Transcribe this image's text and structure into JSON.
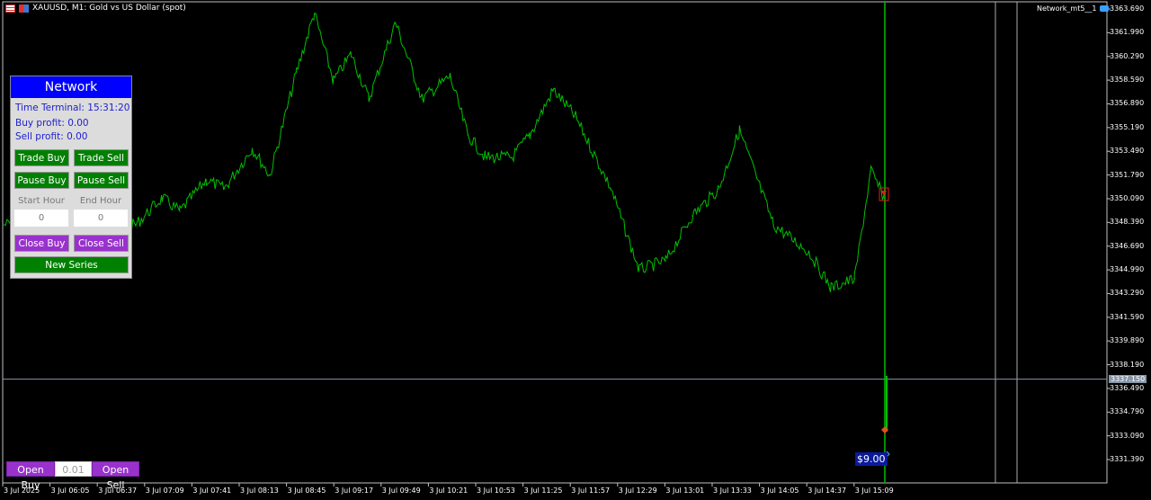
{
  "window": {
    "title": "XAUUSD, M1:  Gold vs US Dollar (spot)",
    "indicator": "Network_mt5__1"
  },
  "panel": {
    "title": "Network",
    "time_terminal": "Time Terminal: 15:31:20",
    "buy_profit": "Buy profit: 0.00",
    "sell_profit": "Sell profit: 0.00",
    "trade_buy": "Trade Buy",
    "trade_sell": "Trade Sell",
    "pause_buy": "Pause Buy",
    "pause_sell": "Pause Sell",
    "start_hour_label": "Start Hour",
    "end_hour_label": "End Hour",
    "start_hour": "0",
    "end_hour": "0",
    "close_buy": "Close Buy",
    "close_sell": "Close Sell",
    "new_series": "New Series"
  },
  "order": {
    "open_buy": "Open Buy",
    "lot": "0.01",
    "open_sell": "Open Sell"
  },
  "profit_label": "$9.00",
  "colors": {
    "line": "#00c000",
    "panel_header": "#0000ff",
    "green_button": "#008000",
    "purple_button": "#9932cc"
  },
  "chart_data": {
    "type": "line",
    "symbol": "XAUUSD",
    "timeframe": "M1",
    "price_ticks": [
      "3363.690",
      "3361.990",
      "3360.290",
      "3358.590",
      "3356.890",
      "3355.190",
      "3353.490",
      "3351.790",
      "3350.090",
      "3348.390",
      "3346.690",
      "3344.990",
      "3343.290",
      "3341.590",
      "3339.890",
      "3338.190",
      "3336.490",
      "3334.790",
      "3333.090",
      "3331.390"
    ],
    "time_ticks": [
      "3 Jul 2025",
      "3 Jul 06:05",
      "3 Jul 06:37",
      "3 Jul 07:09",
      "3 Jul 07:41",
      "3 Jul 08:13",
      "3 Jul 08:45",
      "3 Jul 09:17",
      "3 Jul 09:49",
      "3 Jul 10:21",
      "3 Jul 10:53",
      "3 Jul 11:25",
      "3 Jul 11:57",
      "3 Jul 12:29",
      "3 Jul 13:01",
      "3 Jul 13:33",
      "3 Jul 14:05",
      "3 Jul 14:37",
      "3 Jul 15:09"
    ],
    "current_price": "3337.150",
    "ylim": [
      3330.5,
      3364.2
    ],
    "points": [
      [
        "05:34",
        3348.22
      ],
      [
        "05:56",
        3348.54
      ],
      [
        "06:32",
        3347.89
      ],
      [
        "07:03",
        3348.22
      ],
      [
        "07:21",
        3350.15
      ],
      [
        "07:33",
        3349.18
      ],
      [
        "07:51",
        3351.44
      ],
      [
        "08:03",
        3350.8
      ],
      [
        "08:22",
        3353.7
      ],
      [
        "08:34",
        3351.76
      ],
      [
        "08:52",
        3359.18
      ],
      [
        "09:04",
        3363.37
      ],
      [
        "09:17",
        3358.53
      ],
      [
        "09:29",
        3360.47
      ],
      [
        "09:41",
        3357.24
      ],
      [
        "09:59",
        3362.72
      ],
      [
        "10:17",
        3357.24
      ],
      [
        "10:36",
        3358.85
      ],
      [
        "10:48",
        3354.66
      ],
      [
        "11:00",
        3353.05
      ],
      [
        "11:18",
        3353.05
      ],
      [
        "11:30",
        3354.66
      ],
      [
        "11:46",
        3357.89
      ],
      [
        "12:01",
        3355.95
      ],
      [
        "12:25",
        3350.8
      ],
      [
        "12:44",
        3344.99
      ],
      [
        "13:02",
        3345.64
      ],
      [
        "13:20",
        3348.86
      ],
      [
        "13:38",
        3350.8
      ],
      [
        "13:52",
        3354.99
      ],
      [
        "14:15",
        3348.22
      ],
      [
        "14:39",
        3346.28
      ],
      [
        "14:54",
        3343.7
      ],
      [
        "15:10",
        3344.35
      ],
      [
        "15:21",
        3352.09
      ],
      [
        "15:30",
        3350.15
      ]
    ]
  }
}
